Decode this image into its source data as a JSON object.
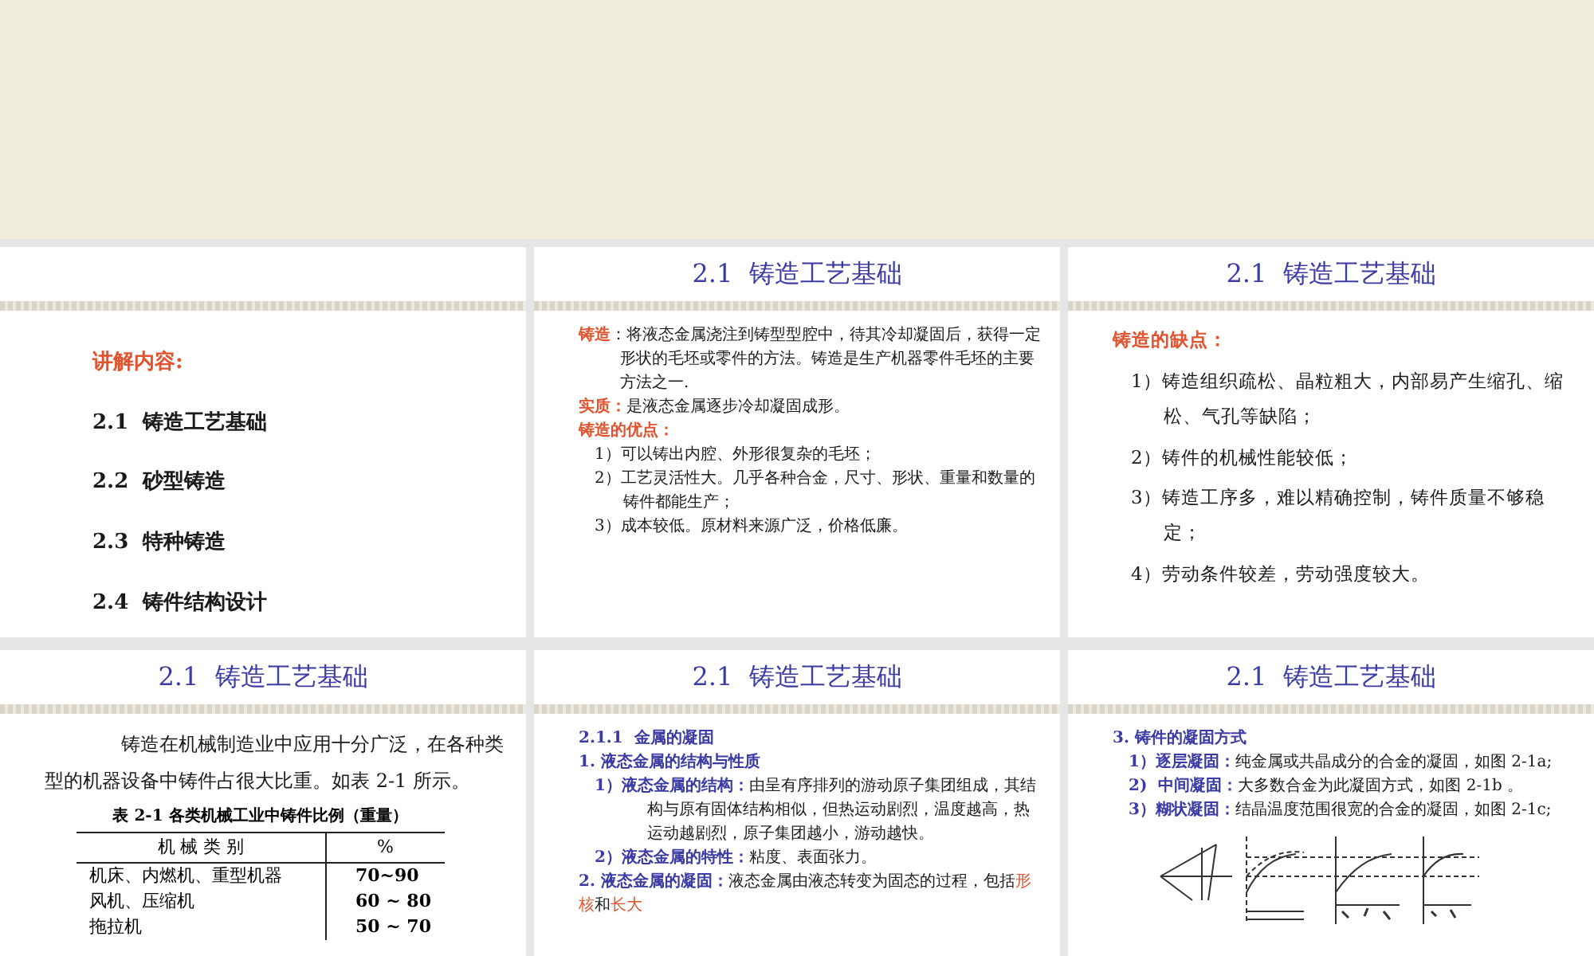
{
  "slides": [
    {
      "kind": "toc",
      "blocks": [
        {
          "kind": "lead",
          "runs": [
            {
              "text": "讲解内容:",
              "color": "#e2532e",
              "bold": true
            }
          ]
        },
        {
          "kind": "toc",
          "runs": [
            {
              "text": "2.1  铸造工艺基础",
              "color": "#1a1a1a",
              "bold": true
            }
          ]
        },
        {
          "kind": "toc",
          "runs": [
            {
              "text": "2.2  砂型铸造",
              "color": "#1a1a1a",
              "bold": true
            }
          ]
        },
        {
          "kind": "toc",
          "runs": [
            {
              "text": "2.3  特种铸造",
              "color": "#1a1a1a",
              "bold": true
            }
          ]
        },
        {
          "kind": "toc",
          "runs": [
            {
              "text": "2.4  铸件结构设计",
              "color": "#1a1a1a",
              "bold": true
            }
          ]
        }
      ]
    },
    {
      "kind": "dense",
      "title": "2.1  铸造工艺基础",
      "blocks": [
        {
          "kind": "hang",
          "runs": [
            {
              "text": "铸造",
              "color": "#e2532e",
              "bold": true
            },
            {
              "text": "：将液态金属浇注到铸型型腔中，待其冷却凝固后，获得一定形状的毛坯或零件的方法。铸造是生产机器零件毛坯的主要方法之一.",
              "color": "#1a1a1a",
              "bold": false
            }
          ]
        },
        {
          "kind": "para",
          "runs": [
            {
              "text": "实质：",
              "color": "#e2532e",
              "bold": true
            },
            {
              "text": "是液态金属逐步冷却凝固成形。",
              "color": "#1a1a1a",
              "bold": false
            }
          ]
        },
        {
          "kind": "para",
          "runs": [
            {
              "text": "铸造的优点：",
              "color": "#e2532e",
              "bold": true
            }
          ]
        },
        {
          "kind": "item",
          "runs": [
            {
              "text": "1）可以铸出内腔、外形很复杂的毛坯；",
              "color": "#1a1a1a",
              "bold": false
            }
          ]
        },
        {
          "kind": "item",
          "runs": [
            {
              "text": "2）工艺灵活性大。几乎各种合金，尺寸、形状、重量和数量的铸件都能生产；",
              "color": "#1a1a1a",
              "bold": false
            }
          ]
        },
        {
          "kind": "item",
          "runs": [
            {
              "text": "3）成本较低。原材料来源广泛，价格低廉。",
              "color": "#1a1a1a",
              "bold": false
            }
          ]
        }
      ]
    },
    {
      "kind": "plain",
      "title": "2.1  铸造工艺基础",
      "blocks": [
        {
          "kind": "para",
          "runs": [
            {
              "text": "铸造的缺点：",
              "color": "#e2532e",
              "bold": true
            }
          ]
        },
        {
          "kind": "item",
          "runs": [
            {
              "text": "1）铸造组织疏松、晶粒粗大，内部易产生缩孔、缩松、气孔等缺陷；",
              "color": "#1a1a1a",
              "bold": false
            }
          ]
        },
        {
          "kind": "item",
          "runs": [
            {
              "text": "2）铸件的机械性能较低；",
              "color": "#1a1a1a",
              "bold": false
            }
          ]
        },
        {
          "kind": "item",
          "runs": [
            {
              "text": "3）铸造工序多，难以精确控制，铸件质量不够稳定；",
              "color": "#1a1a1a",
              "bold": false
            }
          ]
        },
        {
          "kind": "item",
          "runs": [
            {
              "text": "4）劳动条件较差，劳动强度较大。",
              "color": "#1a1a1a",
              "bold": false
            }
          ]
        }
      ]
    },
    {
      "kind": "plain",
      "title": "2.1  铸造工艺基础",
      "blocks": [
        {
          "kind": "indent",
          "runs": [
            {
              "text": "铸造在机械制造业中应用十分广泛，在各种类型的机器设备中铸件占很大比重。如表 2-1 所示。",
              "color": "#1a1a1a",
              "bold": false
            }
          ]
        },
        {
          "kind": "table",
          "caption": "表 2-1  各类机械工业中铸件比例（重量）",
          "columns": [
            "机 械 类 别",
            "%"
          ],
          "rows": [
            [
              "机床、内燃机、重型机器",
              "70~90"
            ],
            [
              "风机、压缩机",
              "60 ~ 80"
            ],
            [
              "拖拉机",
              "50 ~ 70"
            ]
          ]
        }
      ]
    },
    {
      "kind": "dense",
      "title": "2.1  铸造工艺基础",
      "blocks": [
        {
          "kind": "para",
          "runs": [
            {
              "text": "2.1.1  金属的凝固",
              "color": "#3b3ba6",
              "bold": true
            }
          ]
        },
        {
          "kind": "para",
          "runs": [
            {
              "text": "1. 液态金属的结构与性质",
              "color": "#3b3ba6",
              "bold": true
            }
          ]
        },
        {
          "kind": "hangitem",
          "runs": [
            {
              "text": "1）液态金属的结构：",
              "color": "#3b3ba6",
              "bold": true
            },
            {
              "text": "由呈有序排列的游动原子集团组成，其结构与原有固体结构相似，但热运动剧烈，温度越高，热运动越剧烈，原子集团越小，游动越快。",
              "color": "#1a1a1a",
              "bold": false
            }
          ]
        },
        {
          "kind": "item",
          "runs": [
            {
              "text": "2）液态金属的特性：",
              "color": "#3b3ba6",
              "bold": true
            },
            {
              "text": "粘度、表面张力。",
              "color": "#1a1a1a",
              "bold": false
            }
          ]
        },
        {
          "kind": "para",
          "runs": [
            {
              "text": "2. 液态金属的凝固：",
              "color": "#3b3ba6",
              "bold": true
            },
            {
              "text": "液态金属由液态转变为固态的过程，包括",
              "color": "#1a1a1a",
              "bold": false
            },
            {
              "text": "形核",
              "color": "#e2532e",
              "bold": false
            },
            {
              "text": "和",
              "color": "#1a1a1a",
              "bold": false
            },
            {
              "text": "长大",
              "color": "#e2532e",
              "bold": false
            }
          ]
        }
      ]
    },
    {
      "kind": "dense",
      "title": "2.1  铸造工艺基础",
      "blocks": [
        {
          "kind": "para",
          "runs": [
            {
              "text": "3. 铸件的凝固方式",
              "color": "#3b3ba6",
              "bold": true
            }
          ]
        },
        {
          "kind": "item",
          "runs": [
            {
              "text": "1）逐层凝固：",
              "color": "#3b3ba6",
              "bold": true
            },
            {
              "text": "纯金属或共晶成分的合金的凝固，如图 2-1a;",
              "color": "#1a1a1a",
              "bold": false
            }
          ]
        },
        {
          "kind": "item",
          "runs": [
            {
              "text": "2)  中间凝固：",
              "color": "#3b3ba6",
              "bold": true
            },
            {
              "text": "大多数合金为此凝固方式，如图 2-1b 。",
              "color": "#1a1a1a",
              "bold": false
            }
          ]
        },
        {
          "kind": "item",
          "runs": [
            {
              "text": "3）糊状凝固：",
              "color": "#3b3ba6",
              "bold": true
            },
            {
              "text": "结晶温度范围很宽的合金的凝固，如图 2-1c;",
              "color": "#1a1a1a",
              "bold": false
            }
          ]
        },
        {
          "kind": "figure"
        }
      ]
    }
  ]
}
